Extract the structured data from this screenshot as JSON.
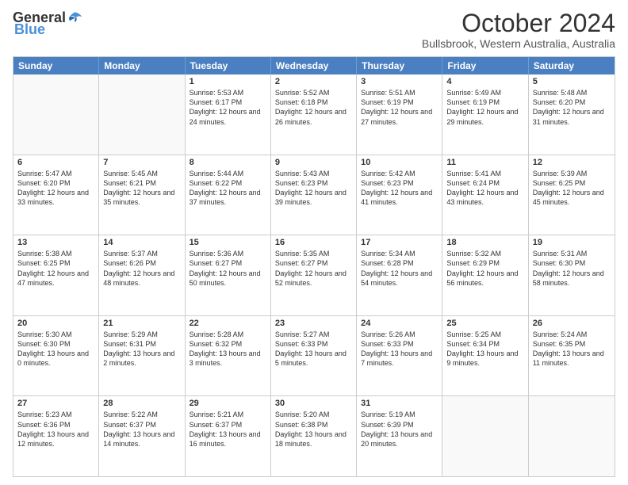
{
  "logo": {
    "general": "General",
    "blue": "Blue"
  },
  "title": "October 2024",
  "location": "Bullsbrook, Western Australia, Australia",
  "weekdays": [
    "Sunday",
    "Monday",
    "Tuesday",
    "Wednesday",
    "Thursday",
    "Friday",
    "Saturday"
  ],
  "rows": [
    [
      {
        "day": "",
        "info": ""
      },
      {
        "day": "",
        "info": ""
      },
      {
        "day": "1",
        "info": "Sunrise: 5:53 AM\nSunset: 6:17 PM\nDaylight: 12 hours and 24 minutes."
      },
      {
        "day": "2",
        "info": "Sunrise: 5:52 AM\nSunset: 6:18 PM\nDaylight: 12 hours and 26 minutes."
      },
      {
        "day": "3",
        "info": "Sunrise: 5:51 AM\nSunset: 6:19 PM\nDaylight: 12 hours and 27 minutes."
      },
      {
        "day": "4",
        "info": "Sunrise: 5:49 AM\nSunset: 6:19 PM\nDaylight: 12 hours and 29 minutes."
      },
      {
        "day": "5",
        "info": "Sunrise: 5:48 AM\nSunset: 6:20 PM\nDaylight: 12 hours and 31 minutes."
      }
    ],
    [
      {
        "day": "6",
        "info": "Sunrise: 5:47 AM\nSunset: 6:20 PM\nDaylight: 12 hours and 33 minutes."
      },
      {
        "day": "7",
        "info": "Sunrise: 5:45 AM\nSunset: 6:21 PM\nDaylight: 12 hours and 35 minutes."
      },
      {
        "day": "8",
        "info": "Sunrise: 5:44 AM\nSunset: 6:22 PM\nDaylight: 12 hours and 37 minutes."
      },
      {
        "day": "9",
        "info": "Sunrise: 5:43 AM\nSunset: 6:23 PM\nDaylight: 12 hours and 39 minutes."
      },
      {
        "day": "10",
        "info": "Sunrise: 5:42 AM\nSunset: 6:23 PM\nDaylight: 12 hours and 41 minutes."
      },
      {
        "day": "11",
        "info": "Sunrise: 5:41 AM\nSunset: 6:24 PM\nDaylight: 12 hours and 43 minutes."
      },
      {
        "day": "12",
        "info": "Sunrise: 5:39 AM\nSunset: 6:25 PM\nDaylight: 12 hours and 45 minutes."
      }
    ],
    [
      {
        "day": "13",
        "info": "Sunrise: 5:38 AM\nSunset: 6:25 PM\nDaylight: 12 hours and 47 minutes."
      },
      {
        "day": "14",
        "info": "Sunrise: 5:37 AM\nSunset: 6:26 PM\nDaylight: 12 hours and 48 minutes."
      },
      {
        "day": "15",
        "info": "Sunrise: 5:36 AM\nSunset: 6:27 PM\nDaylight: 12 hours and 50 minutes."
      },
      {
        "day": "16",
        "info": "Sunrise: 5:35 AM\nSunset: 6:27 PM\nDaylight: 12 hours and 52 minutes."
      },
      {
        "day": "17",
        "info": "Sunrise: 5:34 AM\nSunset: 6:28 PM\nDaylight: 12 hours and 54 minutes."
      },
      {
        "day": "18",
        "info": "Sunrise: 5:32 AM\nSunset: 6:29 PM\nDaylight: 12 hours and 56 minutes."
      },
      {
        "day": "19",
        "info": "Sunrise: 5:31 AM\nSunset: 6:30 PM\nDaylight: 12 hours and 58 minutes."
      }
    ],
    [
      {
        "day": "20",
        "info": "Sunrise: 5:30 AM\nSunset: 6:30 PM\nDaylight: 13 hours and 0 minutes."
      },
      {
        "day": "21",
        "info": "Sunrise: 5:29 AM\nSunset: 6:31 PM\nDaylight: 13 hours and 2 minutes."
      },
      {
        "day": "22",
        "info": "Sunrise: 5:28 AM\nSunset: 6:32 PM\nDaylight: 13 hours and 3 minutes."
      },
      {
        "day": "23",
        "info": "Sunrise: 5:27 AM\nSunset: 6:33 PM\nDaylight: 13 hours and 5 minutes."
      },
      {
        "day": "24",
        "info": "Sunrise: 5:26 AM\nSunset: 6:33 PM\nDaylight: 13 hours and 7 minutes."
      },
      {
        "day": "25",
        "info": "Sunrise: 5:25 AM\nSunset: 6:34 PM\nDaylight: 13 hours and 9 minutes."
      },
      {
        "day": "26",
        "info": "Sunrise: 5:24 AM\nSunset: 6:35 PM\nDaylight: 13 hours and 11 minutes."
      }
    ],
    [
      {
        "day": "27",
        "info": "Sunrise: 5:23 AM\nSunset: 6:36 PM\nDaylight: 13 hours and 12 minutes."
      },
      {
        "day": "28",
        "info": "Sunrise: 5:22 AM\nSunset: 6:37 PM\nDaylight: 13 hours and 14 minutes."
      },
      {
        "day": "29",
        "info": "Sunrise: 5:21 AM\nSunset: 6:37 PM\nDaylight: 13 hours and 16 minutes."
      },
      {
        "day": "30",
        "info": "Sunrise: 5:20 AM\nSunset: 6:38 PM\nDaylight: 13 hours and 18 minutes."
      },
      {
        "day": "31",
        "info": "Sunrise: 5:19 AM\nSunset: 6:39 PM\nDaylight: 13 hours and 20 minutes."
      },
      {
        "day": "",
        "info": ""
      },
      {
        "day": "",
        "info": ""
      }
    ]
  ]
}
